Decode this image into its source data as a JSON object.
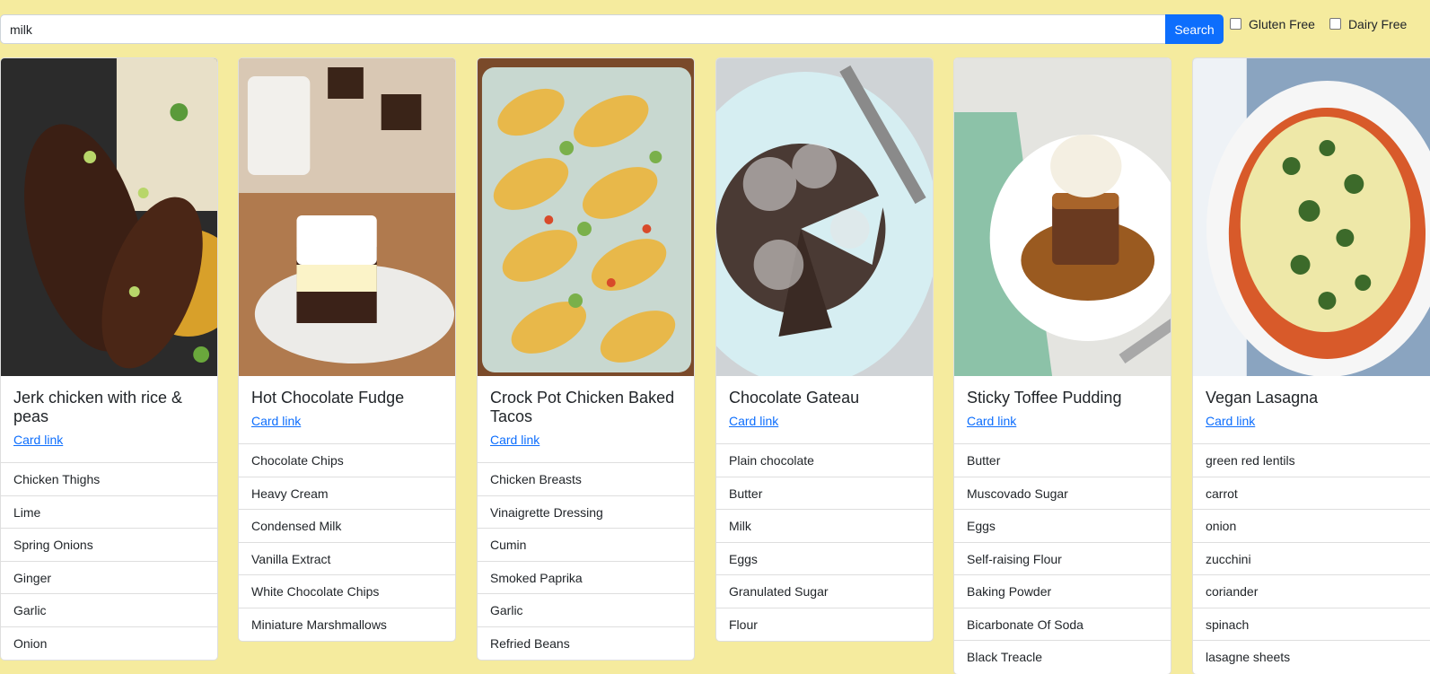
{
  "search": {
    "value": "milk",
    "button_label": "Search"
  },
  "filters": [
    {
      "label": "Gluten Free",
      "checked": false
    },
    {
      "label": "Dairy Free",
      "checked": false
    }
  ],
  "colors": {
    "background": "#f5eb9e",
    "primary": "#0d6efd"
  },
  "recipes": [
    {
      "title": "Jerk chicken with rice & peas",
      "link_label": "Card link",
      "image": "jerk-chicken-photo",
      "ingredients": [
        "Chicken Thighs",
        "Lime",
        "Spring Onions",
        "Ginger",
        "Garlic",
        "Onion"
      ]
    },
    {
      "title": "Hot Chocolate Fudge",
      "link_label": "Card link",
      "image": "hot-chocolate-fudge-photo",
      "ingredients": [
        "Chocolate Chips",
        "Heavy Cream",
        "Condensed Milk",
        "Vanilla Extract",
        "White Chocolate Chips",
        "Miniature Marshmallows"
      ]
    },
    {
      "title": "Crock Pot Chicken Baked Tacos",
      "link_label": "Card link",
      "image": "baked-tacos-photo",
      "ingredients": [
        "Chicken Breasts",
        "Vinaigrette Dressing",
        "Cumin",
        "Smoked Paprika",
        "Garlic",
        "Refried Beans"
      ]
    },
    {
      "title": "Chocolate Gateau",
      "link_label": "Card link",
      "image": "chocolate-gateau-photo",
      "ingredients": [
        "Plain chocolate",
        "Butter",
        "Milk",
        "Eggs",
        "Granulated Sugar",
        "Flour"
      ]
    },
    {
      "title": "Sticky Toffee Pudding",
      "link_label": "Card link",
      "image": "sticky-toffee-pudding-photo",
      "ingredients": [
        "Butter",
        "Muscovado Sugar",
        "Eggs",
        "Self-raising Flour",
        "Baking Powder",
        "Bicarbonate Of Soda",
        "Black Treacle"
      ]
    },
    {
      "title": "Vegan Lasagna",
      "link_label": "Card link",
      "image": "vegan-lasagna-photo",
      "ingredients": [
        "green red lentils",
        "carrot",
        "onion",
        "zucchini",
        "coriander",
        "spinach",
        "lasagne sheets"
      ]
    }
  ]
}
